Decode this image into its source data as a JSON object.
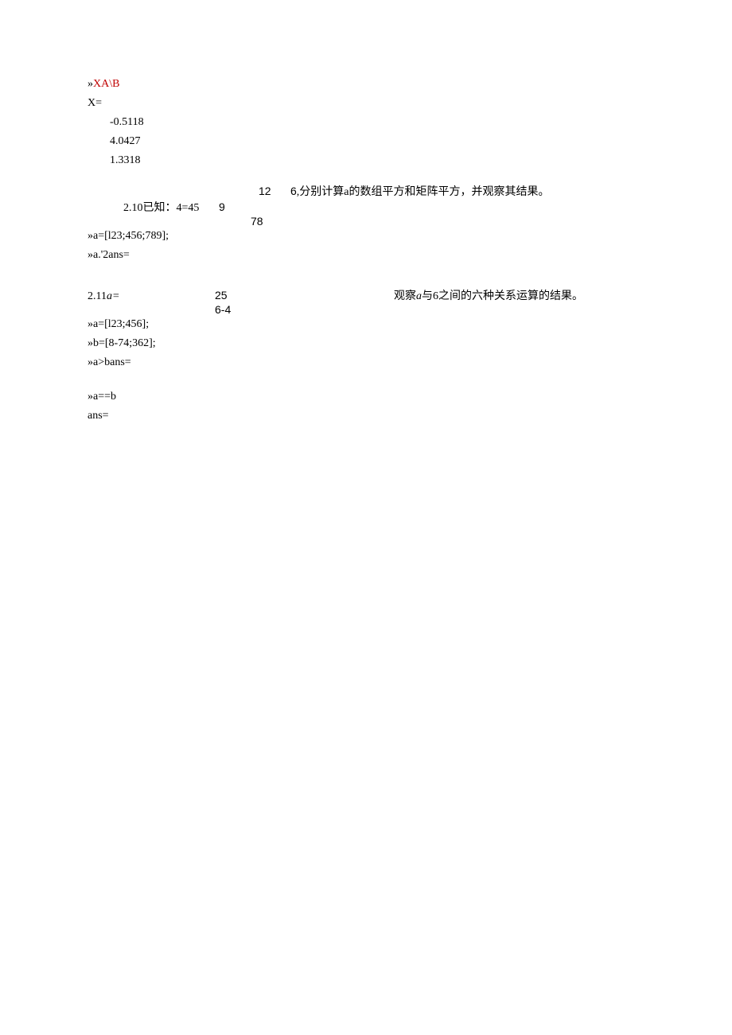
{
  "line1_prefix": "»",
  "line1_red": "XA\\B",
  "line2": "X=",
  "val1": "-0.5118",
  "val2": "4.0427",
  "val3": "1.3318",
  "q210": {
    "row1_right": "12",
    "num6": "6",
    "desc": ",分别计算a的数组平方和矩阵平方，并观察其结果。",
    "label": "2.10已知：4=45",
    "nine": "9",
    "seventy8": "78",
    "code1": "»a=[l23;456;789];",
    "code2": "»a.'2ans="
  },
  "q211": {
    "label": "2.11",
    "a_eq": "a=",
    "twentyfive": "25",
    "sixminus4": "6-4",
    "desc": "观察a与6之间的六种关系运算的结果。",
    "code1": "»a=[l23;456];",
    "code2": "»b=[8-74;362];",
    "code3": "»a>bans=",
    "code4": "»a==b",
    "code5": "ans="
  }
}
